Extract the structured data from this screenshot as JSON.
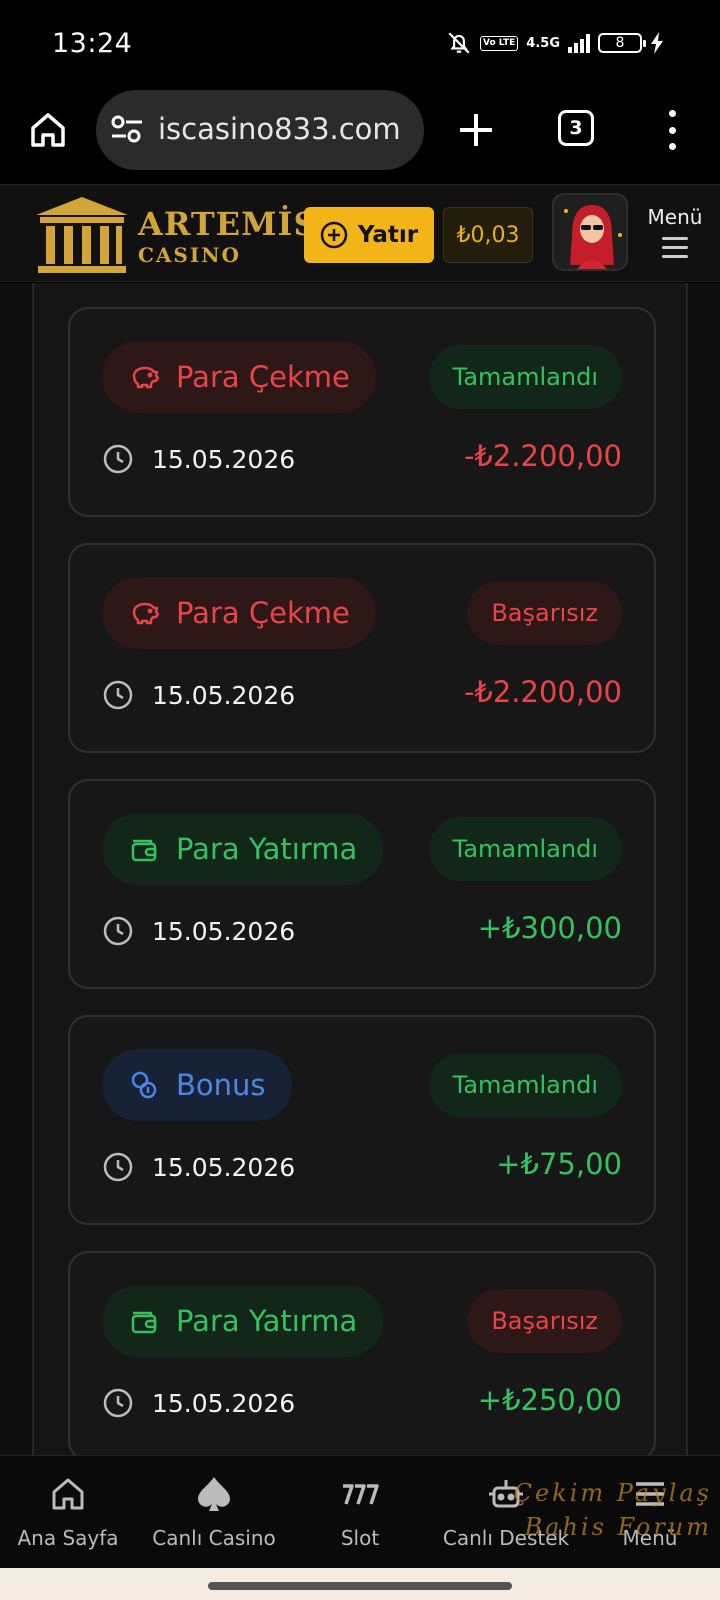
{
  "status_bar": {
    "time": "13:24",
    "network": "4.5G",
    "volte": "Vo LTE",
    "battery": "8"
  },
  "browser": {
    "url": "iscasino833.com",
    "tab_count": "3"
  },
  "header": {
    "logo_title": "ARTEMİS",
    "logo_subtitle": "CASINO",
    "deposit_label": "Yatır",
    "balance": "₺0,03",
    "menu_label": "Menü"
  },
  "transactions": [
    {
      "type": "Para Çekme",
      "kind": "withdraw",
      "status": "Tamamlandı",
      "status_kind": "success",
      "date": "15.05.2026",
      "amount": "-₺2.200,00"
    },
    {
      "type": "Para Çekme",
      "kind": "withdraw",
      "status": "Başarısız",
      "status_kind": "failed",
      "date": "15.05.2026",
      "amount": "-₺2.200,00"
    },
    {
      "type": "Para Yatırma",
      "kind": "deposit",
      "status": "Tamamlandı",
      "status_kind": "success",
      "date": "15.05.2026",
      "amount": "+₺300,00"
    },
    {
      "type": "Bonus",
      "kind": "bonus",
      "status": "Tamamlandı",
      "status_kind": "success",
      "date": "15.05.2026",
      "amount": "+₺75,00"
    },
    {
      "type": "Para Yatırma",
      "kind": "deposit",
      "status": "Başarısız",
      "status_kind": "failed",
      "date": "15.05.2026",
      "amount": "+₺250,00"
    }
  ],
  "bottom_nav": [
    {
      "label": "Ana Sayfa",
      "icon": "home-icon"
    },
    {
      "label": "Canlı Casino",
      "icon": "spade-icon"
    },
    {
      "label": "Slot",
      "icon": "slot-777-icon"
    },
    {
      "label": "Canlı Destek",
      "icon": "support-robot-icon"
    },
    {
      "label": "Menü",
      "icon": "menu-icon"
    }
  ],
  "watermark": {
    "line1": "Çekim Paylaş",
    "line2": "Bahis Forum"
  },
  "colors": {
    "accent_gold": "#f3b417",
    "success_green": "#34c25f",
    "danger_red": "#e8444a",
    "bonus_blue": "#4c87e6"
  }
}
